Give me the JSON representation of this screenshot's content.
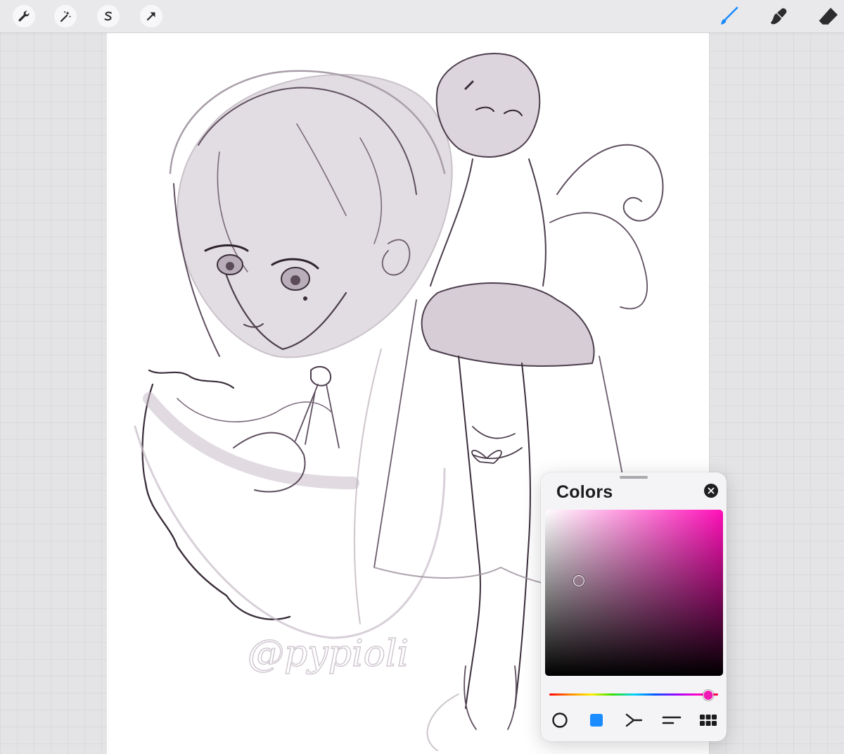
{
  "toolbar": {
    "left_tools": [
      {
        "icon": "wrench-icon",
        "name": "actions"
      },
      {
        "icon": "magic-wand-icon",
        "name": "adjustments"
      },
      {
        "icon": "selection-s-icon",
        "name": "selection"
      },
      {
        "icon": "arrow-cursor-icon",
        "name": "transform"
      }
    ],
    "right_tools": [
      {
        "icon": "brush-icon",
        "name": "paint",
        "active": true
      },
      {
        "icon": "smudge-icon",
        "name": "smudge"
      },
      {
        "icon": "eraser-icon",
        "name": "erase"
      }
    ]
  },
  "canvas": {
    "watermark": "@pypioli"
  },
  "colors_panel": {
    "title": "Colors",
    "hue_color": "#ff10b8",
    "saturation": 0.19,
    "brightness": 0.57,
    "hue_position": 0.94,
    "tabs": [
      {
        "icon": "disc-icon",
        "name": "disc"
      },
      {
        "icon": "classic-square-icon",
        "name": "classic",
        "active": true
      },
      {
        "icon": "harmony-icon",
        "name": "harmony"
      },
      {
        "icon": "value-sliders-icon",
        "name": "value"
      },
      {
        "icon": "palettes-grid-icon",
        "name": "palettes"
      }
    ],
    "accent_color": "#1a8cff"
  }
}
